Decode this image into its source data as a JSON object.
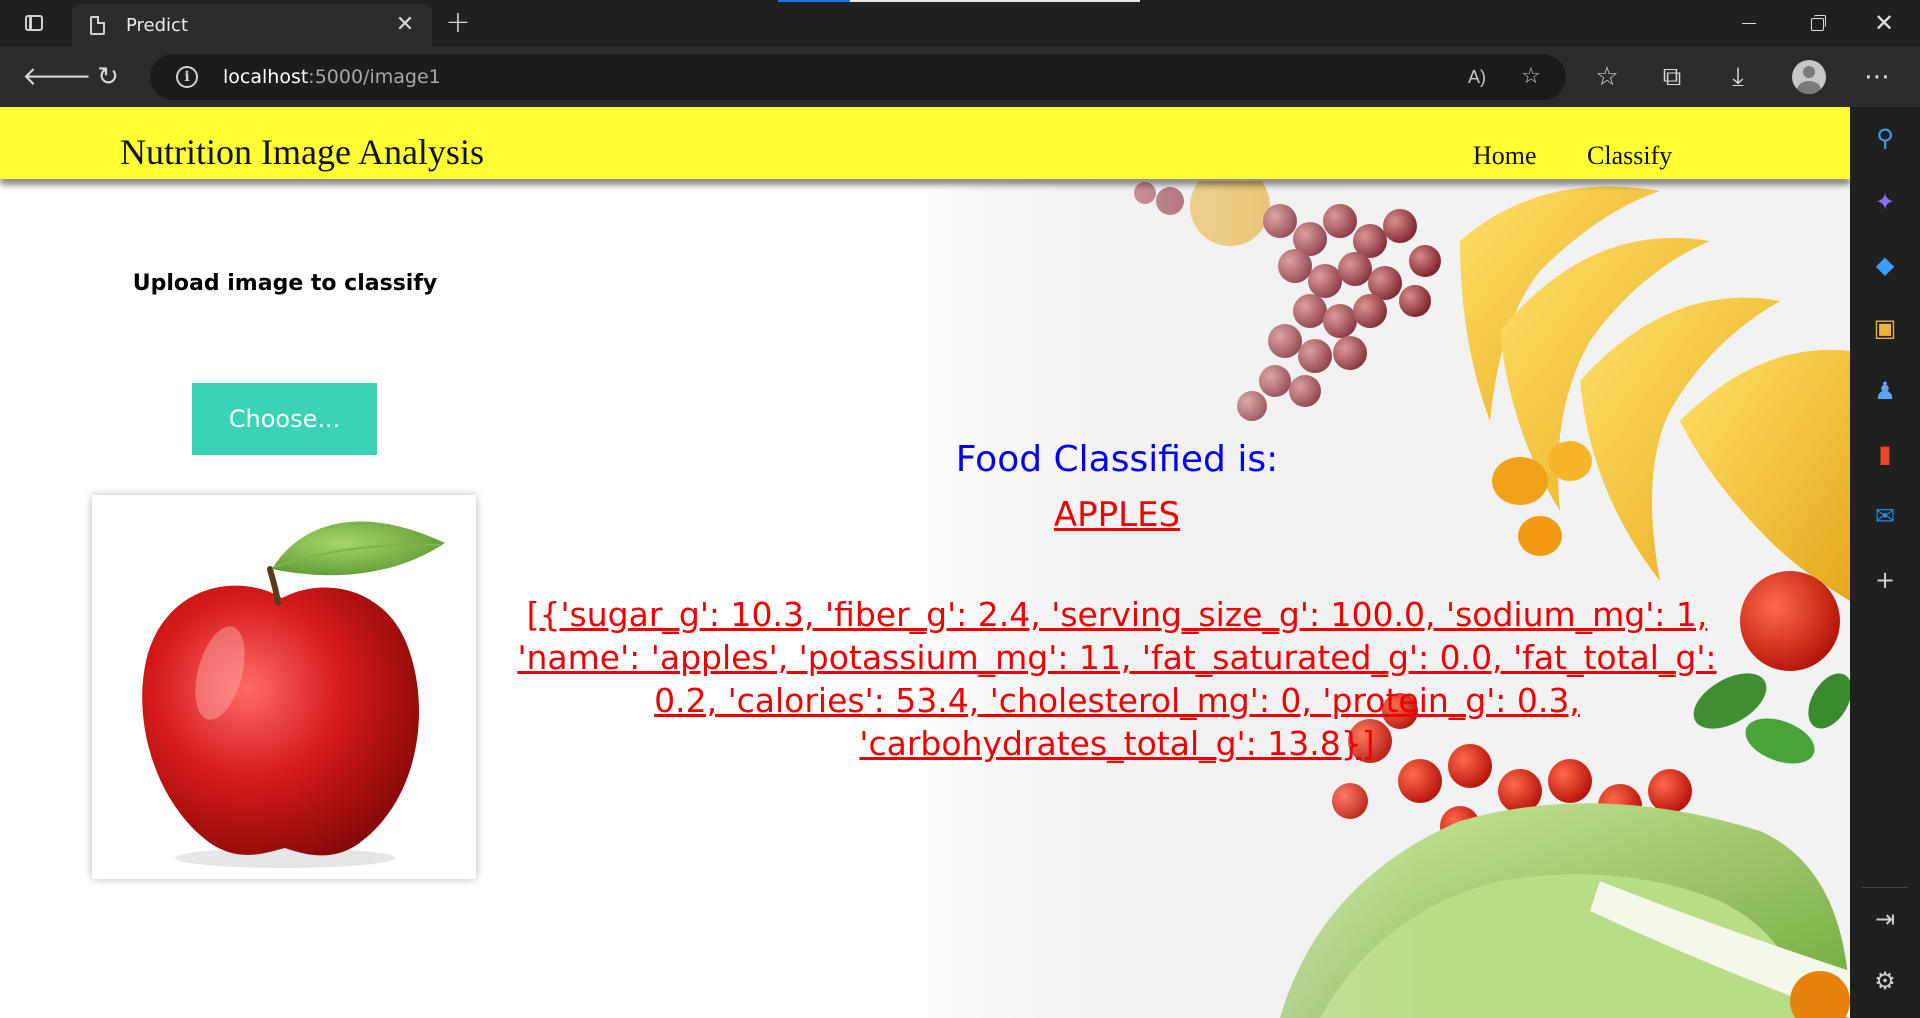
{
  "browser": {
    "tab_title": "Predict",
    "url_host": "localhost",
    "url_path": ":5000/image1"
  },
  "page": {
    "brand": "Nutrition Image Analysis",
    "nav": {
      "home": "Home",
      "classify": "Classify"
    },
    "upload_title": "Upload image to classify",
    "choose_button": "Choose...",
    "result_label": "Food Classified is:",
    "result_class": "APPLES",
    "nutrition_text": "[{'sugar_g': 10.3, 'fiber_g': 2.4, 'serving_size_g': 100.0, 'sodium_mg': 1, 'name': 'apples', 'potassium_mg': 11, 'fat_saturated_g': 0.0, 'fat_total_g': 0.2, 'calories': 53.4, 'cholesterol_mg': 0, 'protein_g': 0.3, 'carbohydrates_total_g': 13.8}]"
  },
  "colors": {
    "navbar": "#ffff33",
    "button": "#3ad3b6",
    "label_blue": "#0000ee",
    "result_red": "#ee0000"
  },
  "load_progress": 0.2
}
